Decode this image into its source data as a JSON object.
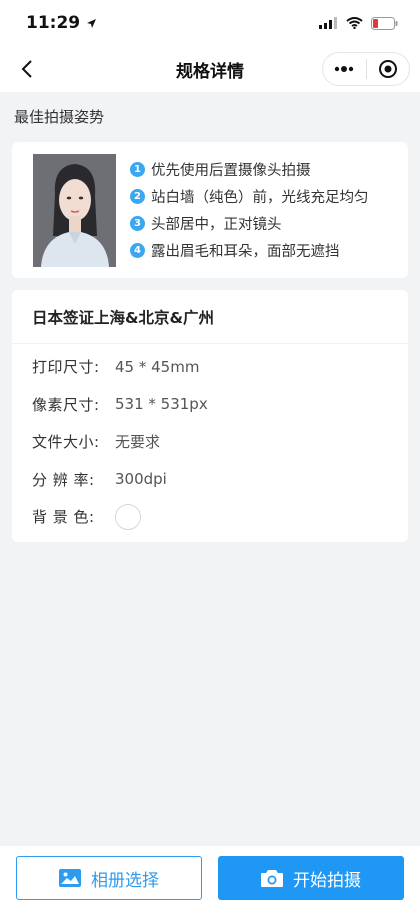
{
  "status": {
    "time": "11:29"
  },
  "nav": {
    "title": "规格详情"
  },
  "section": {
    "title": "最佳拍摄姿势"
  },
  "tips": [
    {
      "num": "1",
      "text": "优先使用后置摄像头拍摄"
    },
    {
      "num": "2",
      "text": "站白墙（纯色）前，光线充足均匀"
    },
    {
      "num": "3",
      "text": "头部居中，正对镜头"
    },
    {
      "num": "4",
      "text": "露出眉毛和耳朵，面部无遮挡"
    }
  ],
  "spec": {
    "name": "日本签证上海&北京&广州",
    "print_size_label": "打印尺寸:",
    "print_size_value": "45 * 45mm",
    "pixel_size_label": "像素尺寸:",
    "pixel_size_value": "531 * 531px",
    "file_size_label": "文件大小:",
    "file_size_value": "无要求",
    "resolution_label": "分 辨 率:",
    "resolution_value": "300dpi",
    "bg_color_label": "背 景 色:",
    "bg_color_value": "#ffffff"
  },
  "buttons": {
    "album": "相册选择",
    "shoot": "开始拍摄"
  },
  "colors": {
    "accent": "#1f97f5",
    "tip_badge": "#3aa7f0",
    "page_bg": "#f2f3f5"
  },
  "icons": [
    "location-arrow-icon",
    "signal-icon",
    "wifi-icon",
    "battery-icon",
    "back-arrow-icon",
    "more-icon",
    "close-mini-program-icon",
    "image-icon",
    "camera-icon"
  ]
}
